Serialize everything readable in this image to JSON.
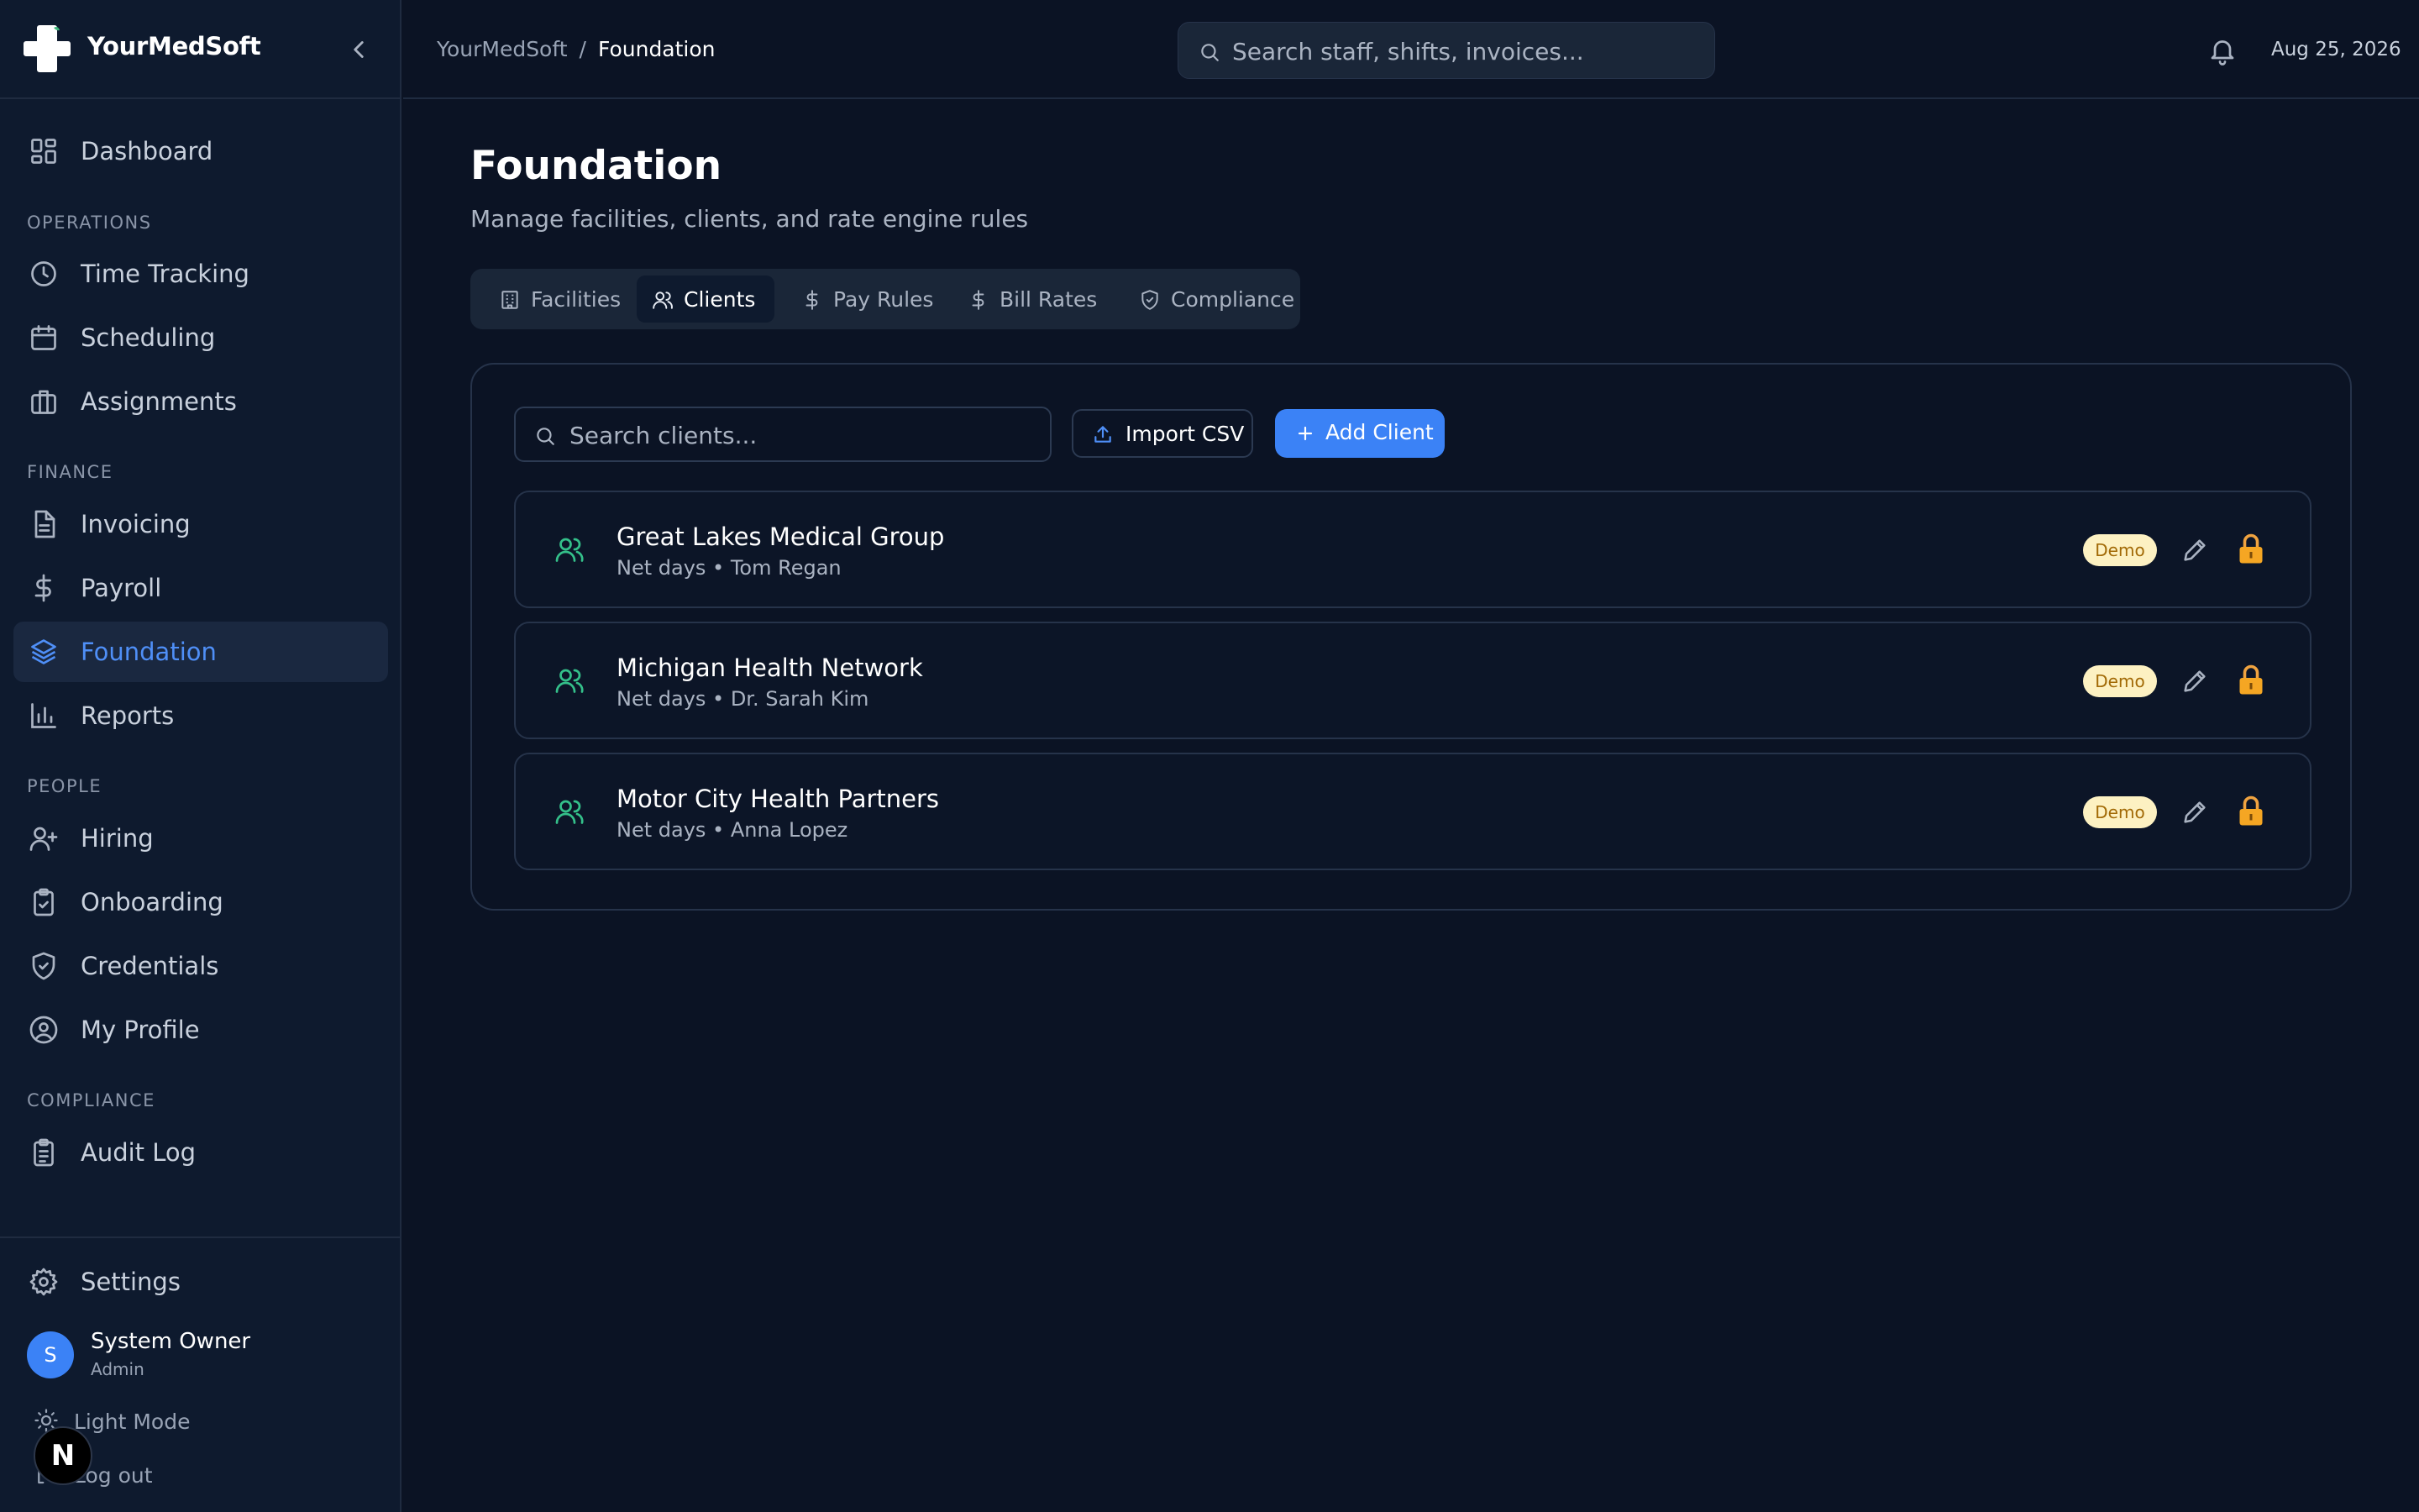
{
  "app": {
    "name": "YourMedSoft"
  },
  "sidebar": {
    "dashboard": "Dashboard",
    "sections": {
      "operations": "OPERATIONS",
      "finance": "FINANCE",
      "people": "PEOPLE",
      "compliance": "COMPLIANCE"
    },
    "items": {
      "time_tracking": "Time Tracking",
      "scheduling": "Scheduling",
      "assignments": "Assignments",
      "invoicing": "Invoicing",
      "payroll": "Payroll",
      "foundation": "Foundation",
      "reports": "Reports",
      "hiring": "Hiring",
      "onboarding": "Onboarding",
      "credentials": "Credentials",
      "my_profile": "My Profile",
      "audit_log": "Audit Log",
      "settings": "Settings"
    },
    "active_item": "Foundation",
    "user": {
      "initial": "S",
      "name": "System Owner",
      "role": "Admin"
    },
    "light_mode": "Light Mode",
    "logout": "Log out",
    "dev_badge": "N"
  },
  "topbar": {
    "breadcrumb": [
      "YourMedSoft",
      "Foundation"
    ],
    "breadcrumb_sep": "/",
    "search_placeholder": "Search staff, shifts, invoices...",
    "date": "Aug 25, 2026"
  },
  "main": {
    "title": "Foundation",
    "subtitle": "Manage facilities, clients, and rate engine rules",
    "tabs": [
      {
        "label": "Facilities",
        "icon": "building-icon"
      },
      {
        "label": "Clients",
        "icon": "users-icon"
      },
      {
        "label": "Pay Rules",
        "icon": "dollar-icon"
      },
      {
        "label": "Bill Rates",
        "icon": "dollar-icon"
      },
      {
        "label": "Compliance",
        "icon": "shield-check-icon"
      }
    ],
    "active_tab": "Clients",
    "client_search_placeholder": "Search clients...",
    "import_label": "Import CSV",
    "add_label": "Add Client",
    "clients": [
      {
        "name": "Great Lakes Medical Group",
        "meta": "Net days • Tom Regan",
        "badge": "Demo"
      },
      {
        "name": "Michigan Health Network",
        "meta": "Net days • Dr. Sarah Kim",
        "badge": "Demo"
      },
      {
        "name": "Motor City Health Partners",
        "meta": "Net days • Anna Lopez",
        "badge": "Demo"
      }
    ]
  },
  "colors": {
    "background": "#0b1324",
    "sidebar": "#0e1a2e",
    "accent": "#3b82f6",
    "client_icon": "#34c08a",
    "badge_bg": "#fdf1c2",
    "badge_text": "#a26a06"
  }
}
